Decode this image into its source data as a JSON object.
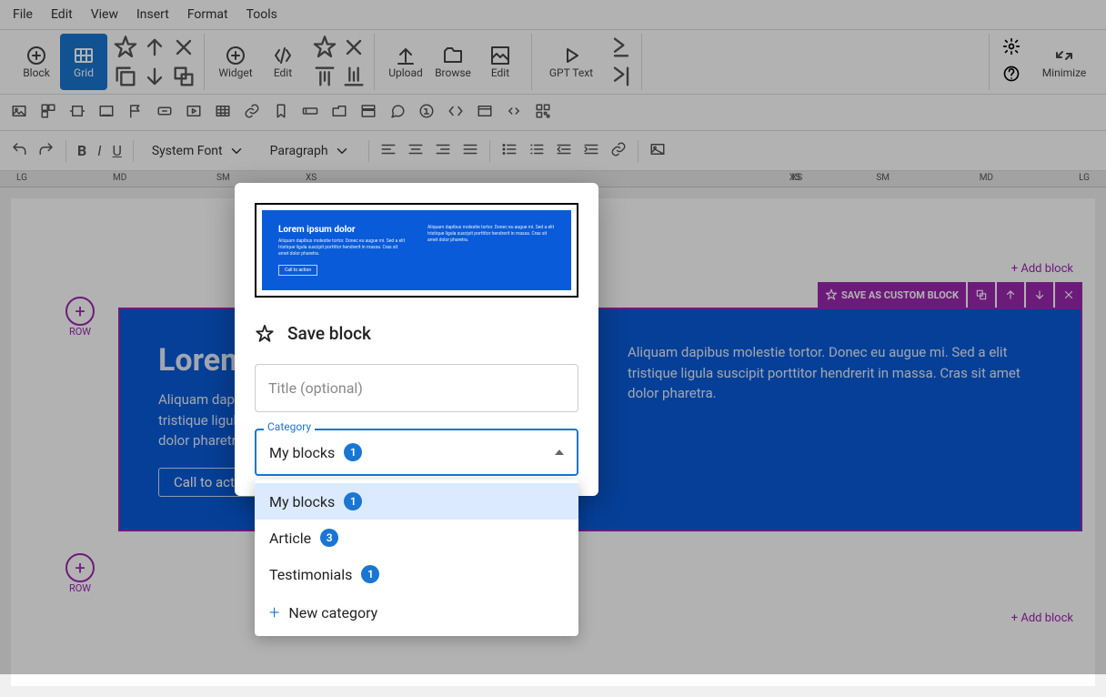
{
  "menubar": [
    "File",
    "Edit",
    "View",
    "Insert",
    "Format",
    "Tools"
  ],
  "toolbar1": {
    "block": "Block",
    "grid": "Grid",
    "widget": "Widget",
    "edit": "Edit",
    "upload": "Upload",
    "browse": "Browse",
    "edit2": "Edit",
    "gpt": "GPT Text",
    "minimize": "Minimize"
  },
  "toolbar3": {
    "font": "System Font",
    "para": "Paragraph"
  },
  "ruler": {
    "lg": "LG",
    "md": "MD",
    "sm": "SM",
    "xs": "XS"
  },
  "canvas": {
    "row": "ROW",
    "add_block": "+ Add block",
    "save_custom": "SAVE AS CUSTOM BLOCK",
    "hero": {
      "title": "Lorem ipsum dolor",
      "para": "Aliquam dapibus molestie tortor. Donec eu augue mi. Sed a elit tristique ligula suscipit porttitor hendrerit in massa. Cras sit amet dolor pharetra.",
      "cta": "Call to action"
    }
  },
  "modal": {
    "title": "Save block",
    "title_placeholder": "Title (optional)",
    "cat_label": "Category",
    "selected": {
      "label": "My blocks",
      "count": "1"
    },
    "options": [
      {
        "label": "My blocks",
        "count": "1",
        "selected": true
      },
      {
        "label": "Article",
        "count": "3"
      },
      {
        "label": "Testimonials",
        "count": "1"
      }
    ],
    "new_cat": "New category",
    "preview": {
      "title": "Lorem ipsum dolor",
      "para": "Aliquam dapibus molestie tortor. Donec eu augue mi. Sed a elit tristique ligula suscipit porttitor hendrerit in massa. Cras sit amet dolor pharetra.",
      "cta": "Call to action"
    }
  }
}
